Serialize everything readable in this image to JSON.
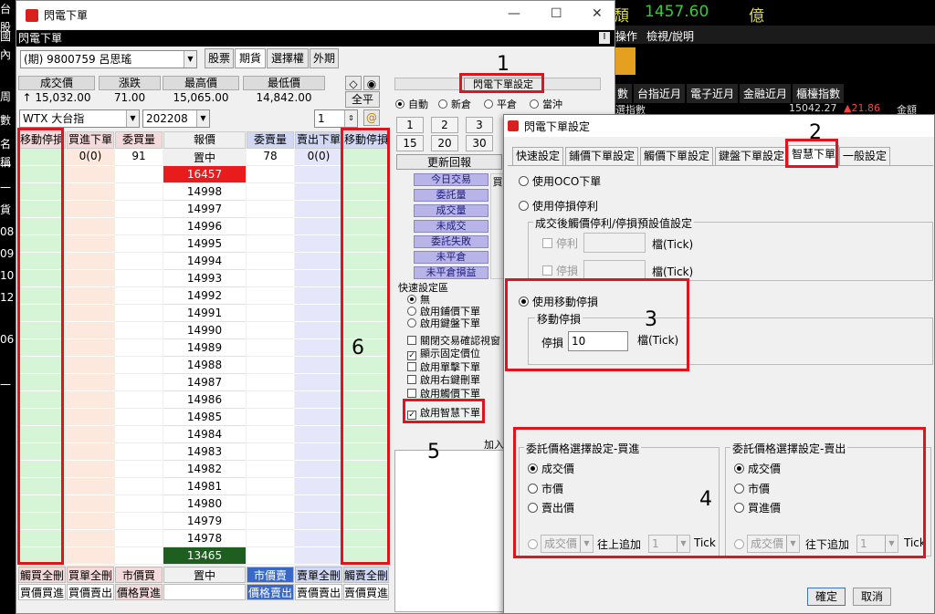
{
  "background": {
    "left_labels": [
      "台股",
      "國內",
      "周",
      "數",
      "名稱",
      "一",
      "一",
      "貨",
      "08",
      "09",
      "10",
      "12",
      "06",
      "一"
    ],
    "price_prefix": "頹",
    "price": "1457.60",
    "price_suffix": "億",
    "menu": [
      "操作",
      "檢視/說明"
    ],
    "tabs": [
      "數",
      "台指近月",
      "電子近月",
      "金融近月",
      "櫃檯指數"
    ],
    "ticker": "選指數",
    "ticker_vals": [
      "15042.27",
      "▲21.86",
      "金額"
    ]
  },
  "main": {
    "title": "閃電下單",
    "bar_title": "閃電下單",
    "bar_btn": "I",
    "account": "(期) 9800759 呂思瑤",
    "tabs": [
      "股票",
      "期貨",
      "選擇權",
      "外期"
    ],
    "quote_headers": [
      "成交價",
      "漲跌",
      "最高價",
      "最低價"
    ],
    "quote_values": [
      "↑ 15,032.00",
      "71.00",
      "15,065.00",
      "14,842.00"
    ],
    "symbol": "WTX  大台指",
    "month": "202208",
    "qty": "1",
    "full_flat": "全平",
    "ladder_headers": [
      "移動停損",
      "買進下單",
      "委買量",
      "報價",
      "委賣量",
      "賣出下單",
      "移動停損"
    ],
    "ladder_summary": [
      "0(0)",
      "91",
      "置中",
      "78",
      "0(0)"
    ],
    "high_price": "16457",
    "prices": [
      "14998",
      "14997",
      "14996",
      "14995",
      "14994",
      "14993",
      "14992",
      "14991",
      "14990",
      "14989",
      "14988",
      "14987",
      "14986",
      "14985",
      "14984",
      "14983",
      "14982",
      "14981",
      "14980",
      "14979",
      "14978"
    ],
    "low_price": "13465",
    "bottom_row1": [
      "觸買全刪",
      "買單全刪",
      "市價買",
      "置中",
      "市價賣",
      "賣單全刪",
      "觸賣全刪"
    ],
    "bottom_row2": [
      "買價買進",
      "買價賣出",
      "價格買進",
      "",
      "價格賣出",
      "賣價賣出",
      "賣價買進"
    ],
    "settings_btn": "閃電下單設定",
    "radios": [
      "自動",
      "新倉",
      "平倉",
      "當沖"
    ],
    "num_buttons": [
      "1",
      "2",
      "3",
      "15",
      "20",
      "30"
    ],
    "refresh": "更新回報",
    "report_buttons": [
      "今日交易",
      "委託量",
      "成交量",
      "未成交",
      "委託失敗",
      "未平倉",
      "未平倉損益"
    ],
    "buy_label": "買",
    "quick_title": "快速設定區",
    "quick_radios": [
      "無",
      "啟用鋪價下單",
      "啟用鍵盤下單"
    ],
    "quick_checks": [
      "關閉交易確認視窗",
      "顯示固定價位",
      "啟用單擊下單",
      "啟用右鍵刪單",
      "啟用觸價下單",
      "啟用智慧下單"
    ],
    "quick_checked": [
      false,
      true,
      false,
      false,
      false,
      true
    ],
    "add_label": "加入"
  },
  "dialog": {
    "title": "閃電下單設定",
    "tabs": [
      "快速設定",
      "鋪價下單設定",
      "觸價下單設定",
      "鍵盤下單設定",
      "智慧下單",
      "一般設定"
    ],
    "oco": "使用OCO下單",
    "stop": "使用停損停利",
    "preset_group": "成交後觸價停利/停損預設值設定",
    "take_profit": "停利",
    "stop_loss": "停損",
    "tick_unit": "檔(Tick)",
    "trailing": "使用移動停損",
    "trailing_group": "移動停損",
    "trailing_label": "停損",
    "trailing_value": "10",
    "buy_group": "委託價格選擇設定-買進",
    "buy_options": [
      "成交價",
      "市價",
      "賣出價"
    ],
    "buy_add_label": "往上追加",
    "sell_group": "委託價格選擇設定-賣出",
    "sell_options": [
      "成交價",
      "市價",
      "買進價"
    ],
    "sell_add_label": "往下追加",
    "combo_value": "成交價",
    "combo_qty": "1",
    "tick": "Tick",
    "ok": "確定",
    "cancel": "取消"
  },
  "annotations": [
    "1",
    "2",
    "3",
    "4",
    "5",
    "6"
  ]
}
